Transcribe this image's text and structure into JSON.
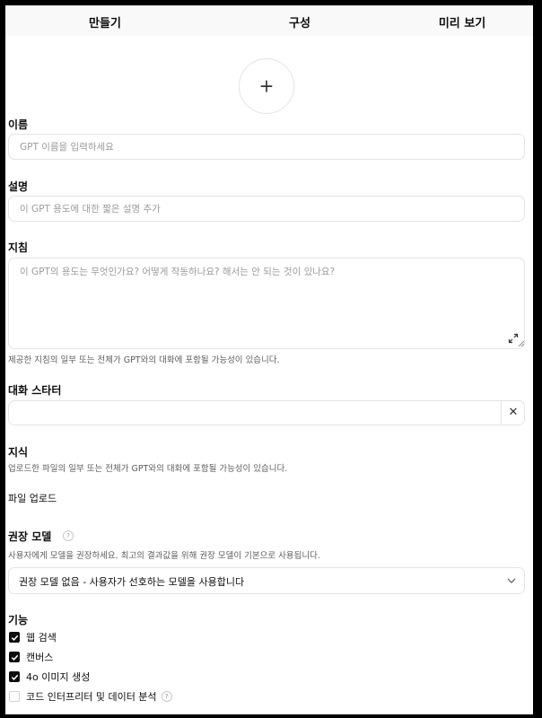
{
  "tabs": [
    {
      "label": "만들기"
    },
    {
      "label": "구성"
    },
    {
      "label": "미리 보기"
    }
  ],
  "avatar": {
    "icon": "plus-icon",
    "glyph": "+"
  },
  "name": {
    "label": "이름",
    "placeholder": "GPT 이름을 입력하세요",
    "value": ""
  },
  "description": {
    "label": "설명",
    "placeholder": "이 GPT 용도에 대한 짧은 설명 추가",
    "value": ""
  },
  "instructions": {
    "label": "지침",
    "placeholder": "이 GPT의 용도는 무엇인가요? 어떻게 작동하나요? 해서는 안 되는 것이 있나요?",
    "value": "",
    "help": "제공한 지침의 일부 또는 전체가 GPT와의 대화에 포함될 가능성이 있습니다."
  },
  "conversation_starters": {
    "label": "대화 스타터",
    "value": "",
    "clear_glyph": "✕"
  },
  "knowledge": {
    "label": "지식",
    "help": "업로드한 파일의 일부 또는 전체가 GPT와의 대화에 포함될 가능성이 있습니다.",
    "upload_label": "파일 업로드"
  },
  "recommended_model": {
    "label": "권장 모델",
    "help_glyph": "?",
    "help": "사용자에게 모델을 권장하세요. 최고의 결과값을 위해 권장 모델이 기본으로 사용됩니다.",
    "selected": "권장 모델 없음 - 사용자가 선호하는 모델을 사용합니다"
  },
  "capabilities": {
    "label": "기능",
    "items": [
      {
        "label": "웹 검색",
        "checked": true
      },
      {
        "label": "캔버스",
        "checked": true
      },
      {
        "label": "4o 이미지 생성",
        "checked": true
      },
      {
        "label": "코드 인터프리터 및 데이터 분석",
        "checked": false
      }
    ],
    "help_glyph": "?"
  },
  "colors": {
    "accent": "#0d0d0d",
    "border": "#e3e3e3",
    "placeholder": "#9b9b9b"
  }
}
